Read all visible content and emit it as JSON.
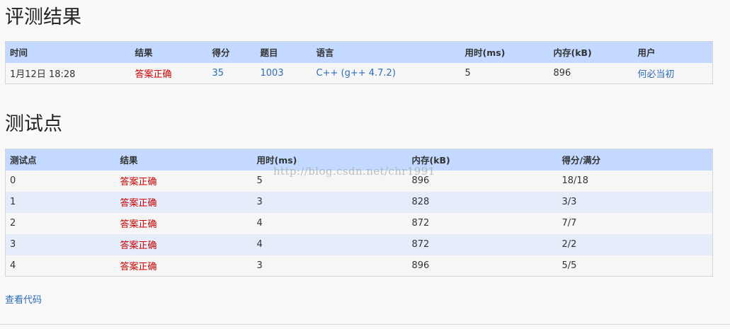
{
  "result_section": {
    "title": "评测结果",
    "headers": [
      "时间",
      "结果",
      "得分",
      "题目",
      "语言",
      "用时(ms)",
      "内存(kB)",
      "用户"
    ],
    "row": {
      "time": "1月12日 18:28",
      "result": "答案正确",
      "score": "35",
      "problem": "1003",
      "language": "C++ (g++ 4.7.2)",
      "time_ms": "5",
      "memory_kb": "896",
      "user": "何必当初"
    }
  },
  "cases_section": {
    "title": "测试点",
    "headers": [
      "测试点",
      "结果",
      "用时(ms)",
      "内存(kB)",
      "得分/满分"
    ],
    "rows": [
      {
        "id": "0",
        "result": "答案正确",
        "time_ms": "5",
        "memory_kb": "896",
        "score": "18/18"
      },
      {
        "id": "1",
        "result": "答案正确",
        "time_ms": "3",
        "memory_kb": "828",
        "score": "3/3"
      },
      {
        "id": "2",
        "result": "答案正确",
        "time_ms": "4",
        "memory_kb": "872",
        "score": "7/7"
      },
      {
        "id": "3",
        "result": "答案正确",
        "time_ms": "4",
        "memory_kb": "872",
        "score": "2/2"
      },
      {
        "id": "4",
        "result": "答案正确",
        "time_ms": "3",
        "memory_kb": "896",
        "score": "5/5"
      }
    ]
  },
  "watermark": "http://blog.csdn.net/chr1991",
  "view_code_link": "查看代码",
  "colors": {
    "header_bg": "#c3d9ff",
    "row_alt_bg": "#e5edfb",
    "accepted_red": "#cc0000",
    "link_blue": "#2c6cb8"
  }
}
